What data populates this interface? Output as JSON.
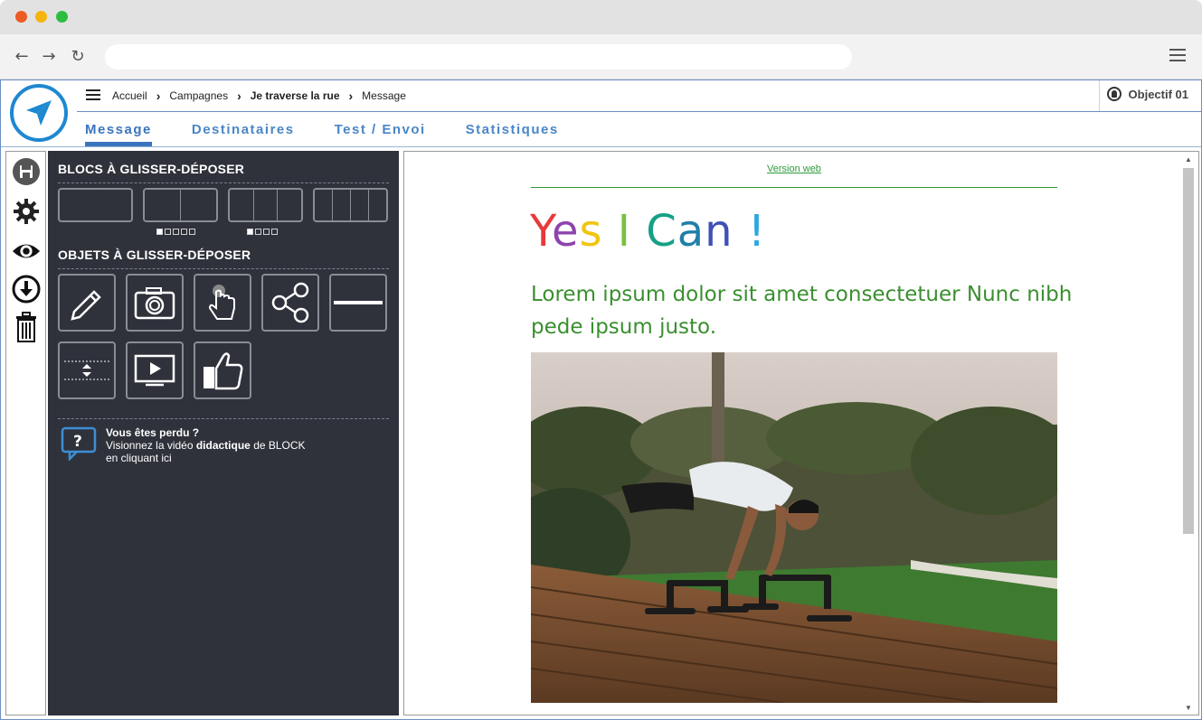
{
  "browser": {
    "back_icon": "arrow-left-icon",
    "forward_icon": "arrow-right-icon",
    "reload_icon": "reload-icon",
    "menu_icon": "hamburger-icon"
  },
  "breadcrumb": {
    "items": [
      "Accueil",
      "Campagnes",
      "Je traverse la rue",
      "Message"
    ]
  },
  "user": {
    "name": "Objectif 01"
  },
  "tabs": [
    {
      "label": "Message",
      "active": true
    },
    {
      "label": "Destinataires",
      "active": false
    },
    {
      "label": "Test / Envoi",
      "active": false
    },
    {
      "label": "Statistiques",
      "active": false
    }
  ],
  "rail": {
    "icons": [
      "save-icon",
      "gear-icon",
      "eye-icon",
      "download-icon",
      "trash-icon"
    ]
  },
  "panel": {
    "blocks_title": "BLOCS À GLISSER-DÉPOSER",
    "objects_title": "OBJETS À GLISSER-DÉPOSER",
    "help": {
      "title": "Vous êtes perdu ?",
      "line1_a": "Visionnez la vidéo ",
      "line1_b": "didactique",
      "line1_c": " de BLOCK",
      "line2_a": "en cliquant ",
      "line2_link": "ici"
    }
  },
  "preview": {
    "version_web": "Version web",
    "headline_letters": [
      {
        "ch": "Y",
        "color": "#e8393a"
      },
      {
        "ch": "e",
        "color": "#8e44ad"
      },
      {
        "ch": "s",
        "color": "#f1c40f"
      },
      {
        "ch": " ",
        "color": "#000000"
      },
      {
        "ch": "I",
        "color": "#7bc043"
      },
      {
        "ch": " ",
        "color": "#000000"
      },
      {
        "ch": "C",
        "color": "#16a085"
      },
      {
        "ch": "a",
        "color": "#1f7fa8"
      },
      {
        "ch": "n",
        "color": "#3f51b5"
      },
      {
        "ch": " ",
        "color": "#000000"
      },
      {
        "ch": "!",
        "color": "#29a8e0"
      }
    ],
    "lorem": "Lorem ipsum dolor sit amet consectetuer Nunc nibh pede ipsum justo.",
    "photo_icon": "fitness-photo"
  },
  "colors": {
    "accent": "#3a74bd",
    "panel_bg": "#2f323b",
    "green": "#2e9b3a"
  }
}
